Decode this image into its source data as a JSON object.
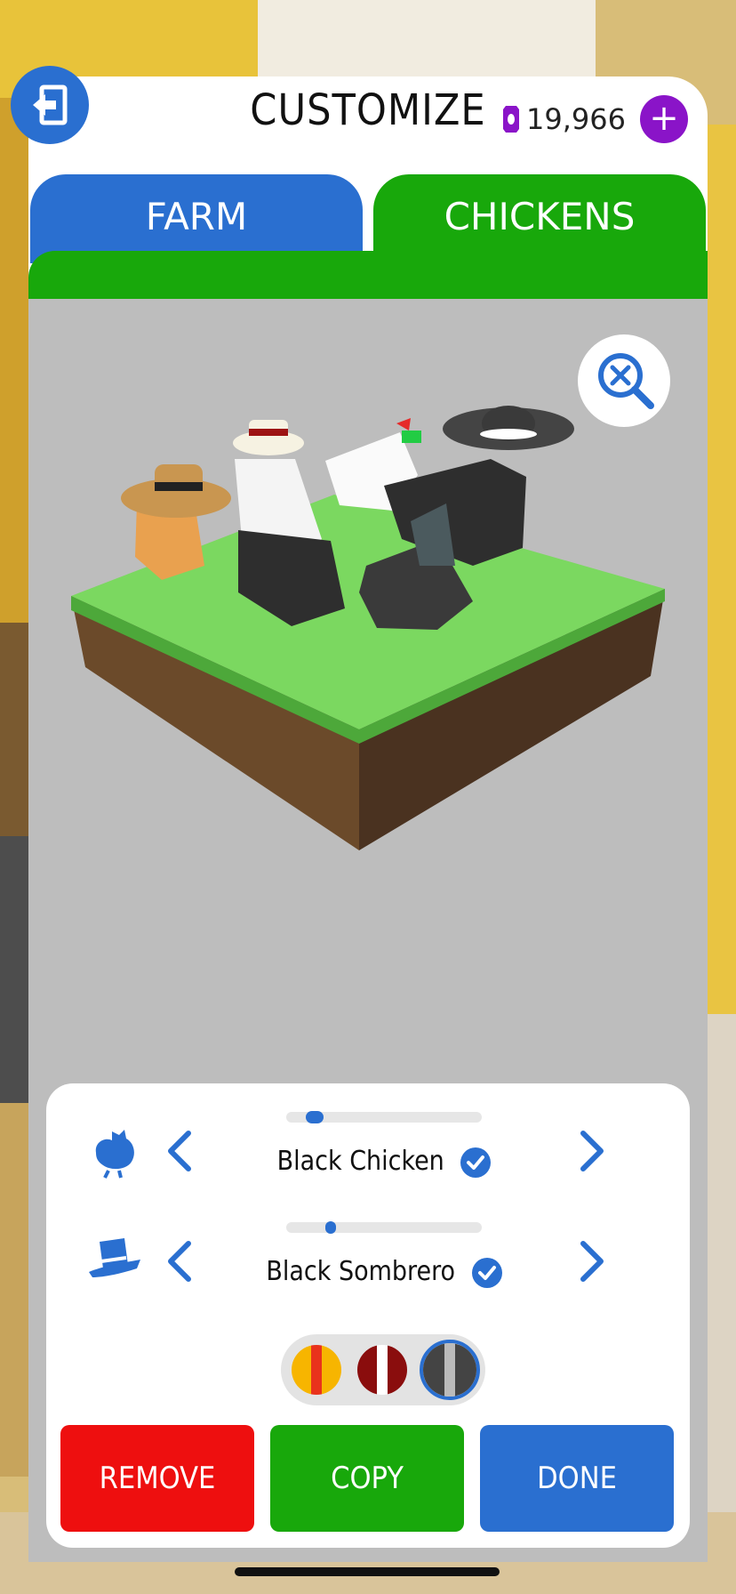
{
  "header": {
    "title": "CUSTOMIZE",
    "currency_value": "19,966",
    "plus_label": "+"
  },
  "tabs": [
    {
      "label": "FARM",
      "active": false
    },
    {
      "label": "CHICKENS",
      "active": true
    }
  ],
  "customizer": {
    "chicken": {
      "label": "Black Chicken",
      "icon": "chicken-icon",
      "selected": true,
      "slider_position": 0.1
    },
    "hat": {
      "label": "Black Sombrero",
      "icon": "hat-icon",
      "selected": true,
      "slider_position": 0.2
    }
  },
  "hat_colors": [
    {
      "name": "yellow-red",
      "colors": [
        "#f7b500",
        "#e9321c",
        "#f7b500"
      ],
      "selected": false
    },
    {
      "name": "red-white",
      "colors": [
        "#8a0d0d",
        "#ffffff",
        "#8a0d0d"
      ],
      "selected": false
    },
    {
      "name": "black-grey",
      "colors": [
        "#444444",
        "#bbbbbb",
        "#444444"
      ],
      "selected": true
    }
  ],
  "actions": {
    "remove_label": "REMOVE",
    "copy_label": "COPY",
    "done_label": "DONE"
  },
  "colors": {
    "blue": "#2a6fd0",
    "green": "#18a80b",
    "red": "#ee0f0f",
    "purple": "#8a14c8"
  }
}
